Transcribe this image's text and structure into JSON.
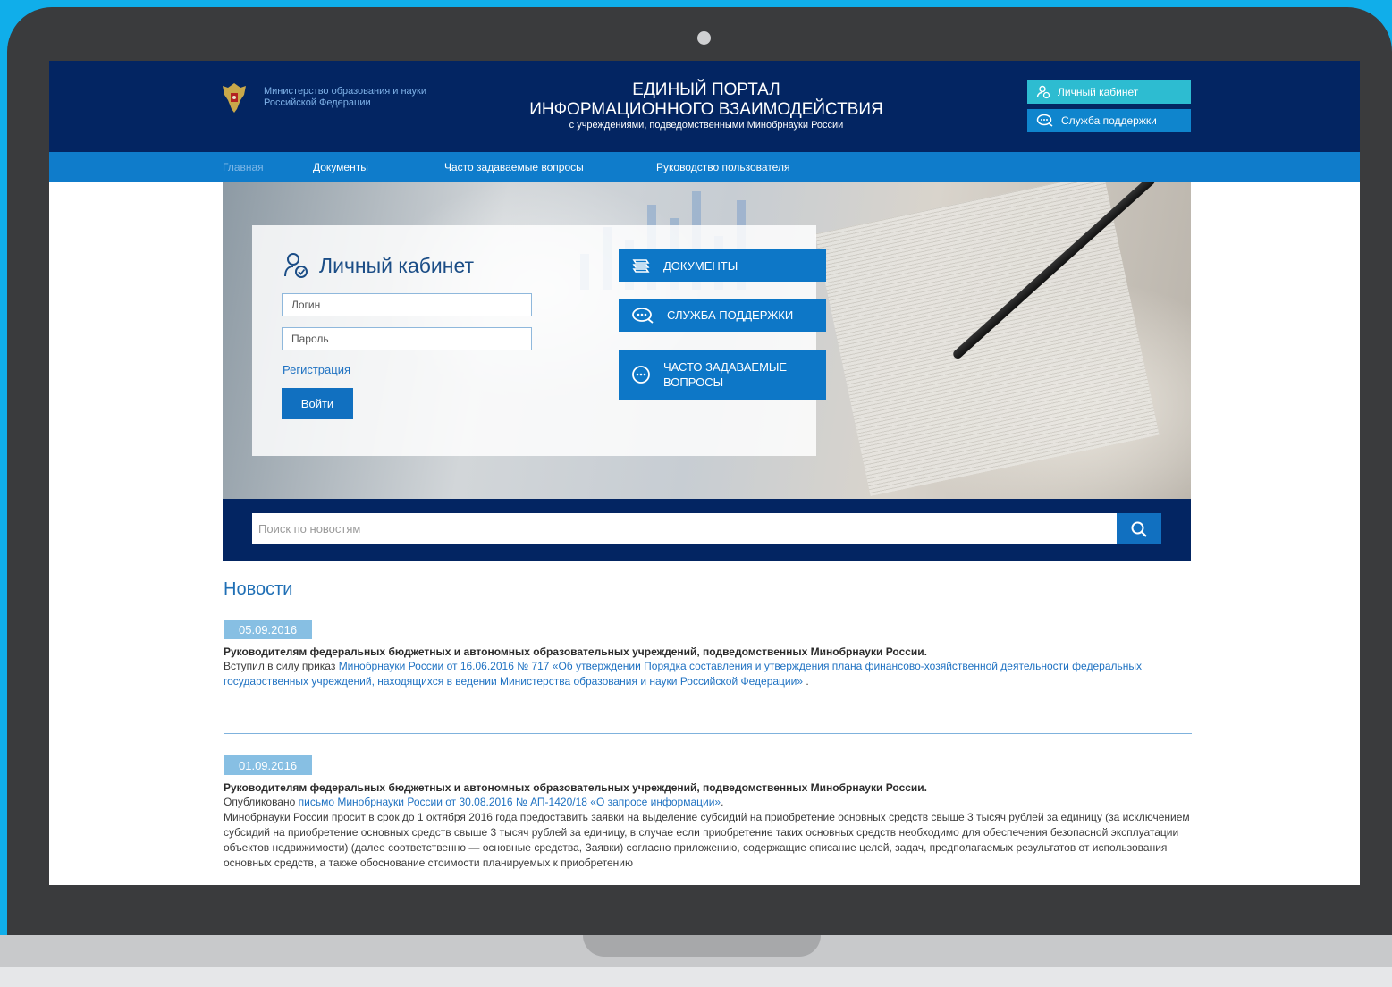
{
  "header": {
    "ministry_line1": "Министерство образования и науки",
    "ministry_line2": "Российской Федерации",
    "portal_line1": "ЕДИНЫЙ ПОРТАЛ",
    "portal_line2": "ИНФОРМАЦИОННОГО ВЗАИМОДЕЙСТВИЯ",
    "portal_line3": "с учреждениями, подведомственными Минобрнауки России",
    "cabinet_button": "Личный кабинет",
    "support_button": "Служба поддержки"
  },
  "nav": {
    "items": [
      "Главная",
      "Документы",
      "Часто задаваемые вопросы",
      "Руководство пользователя"
    ]
  },
  "login": {
    "title": "Личный кабинет",
    "login_placeholder": "Логин",
    "password_placeholder": "Пароль",
    "register_link": "Регистрация",
    "submit_label": "Войти"
  },
  "quick_links": {
    "documents": "ДОКУМЕНТЫ",
    "support": "СЛУЖБА ПОДДЕРЖКИ",
    "faq_line1": "ЧАСТО ЗАДАВАЕМЫЕ",
    "faq_line2": "ВОПРОСЫ"
  },
  "search": {
    "placeholder": "Поиск по новостям"
  },
  "news": {
    "heading": "Новости",
    "items": [
      {
        "date": "05.09.2016",
        "title": "Руководителям федеральных бюджетных и автономных образовательных учреждений, подведомственных Минобрнауки России.",
        "text_prefix": "Вступил в силу приказ ",
        "link": "Минобрнауки России от 16.06.2016 № 717 «Об утверждении Порядка составления и утверждения плана финансово-хозяйственной деятельности федеральных государственных учреждений, находящихся в ведении Министерства образования и науки Российской Федерации»",
        "text_suffix": " ."
      },
      {
        "date": "01.09.2016",
        "title": "Руководителям федеральных бюджетных и автономных образовательных учреждений, подведомственных Минобрнауки России.",
        "text_prefix": "Опубликовано ",
        "link": "письмо Минобрнауки России от 30.08.2016 № АП-1420/18 «О запросе информации»",
        "text_suffix": ".",
        "body": "Минобрнауки России просит в срок до 1 октября 2016 года предоставить заявки на выделение субсидий на приобретение основных средств свыше 3 тысяч рублей за единицу (за исключением субсидий на приобретение основных средств свыше 3 тысяч рублей за единицу, в случае если приобретение таких основных средств необходимо для обеспечения безопасной эксплуатации объектов недвижимости) (далее соответственно — основные средства, Заявки) согласно приложению, содержащие описание целей, задач, предполагаемых результатов от использования основных средств, а также обоснование стоимости планируемых к приобретению"
      }
    ]
  },
  "colors": {
    "header_bg": "#032562",
    "nav_bg": "#0f7ccb",
    "accent": "#1170c0",
    "cabinet_btn": "#2dbcd1",
    "date_badge": "#87bfe3"
  },
  "icons": [
    "emblem-icon",
    "user-icon",
    "chat-icon",
    "documents-icon",
    "faq-icon",
    "search-icon"
  ]
}
